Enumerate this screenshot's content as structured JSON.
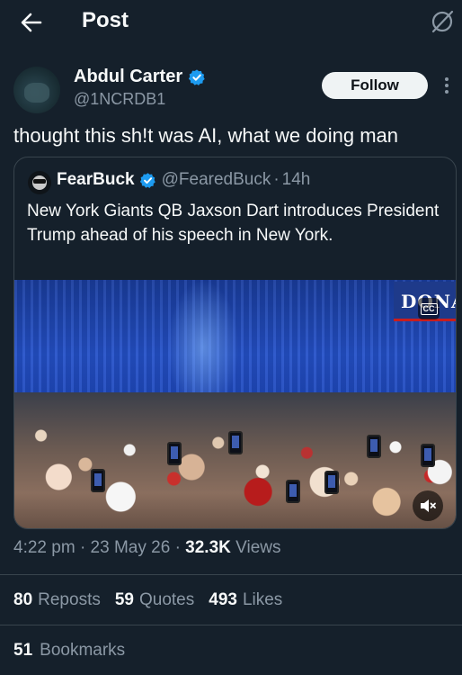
{
  "header": {
    "title": "Post",
    "back_icon": "arrow-left-icon",
    "grok_icon": "grok-slash-circle-icon"
  },
  "author": {
    "name": "Abdul Carter",
    "handle": "@1NCRDB1",
    "follow_label": "Follow",
    "verified_color": "#1d9bf0"
  },
  "tweet": {
    "text": "thought this sh!t was AI, what we doing man"
  },
  "quoted": {
    "name": "FearBuck",
    "handle": "@FearedBuck",
    "separator": "·",
    "time": "14h",
    "text": "New York Giants QB Jaxson Dart introduces President Trump ahead of his speech in New York.",
    "media": {
      "banner_text": "DONALD",
      "cc_label": "CC",
      "mute_icon": "speaker-muted-icon"
    }
  },
  "meta": {
    "time": "4:22 pm",
    "sep1": "·",
    "date": "23 May 26",
    "sep2": "·",
    "views_count": "32.3K",
    "views_label": "Views"
  },
  "stats": {
    "reposts_count": "80",
    "reposts_label": "Reposts",
    "quotes_count": "59",
    "quotes_label": "Quotes",
    "likes_count": "493",
    "likes_label": "Likes",
    "bookmarks_count": "51",
    "bookmarks_label": "Bookmarks"
  },
  "colors": {
    "background": "#15202b",
    "text": "#e7e9ea",
    "secondary": "#8b98a5",
    "border": "#38444d",
    "accent": "#1d9bf0"
  }
}
